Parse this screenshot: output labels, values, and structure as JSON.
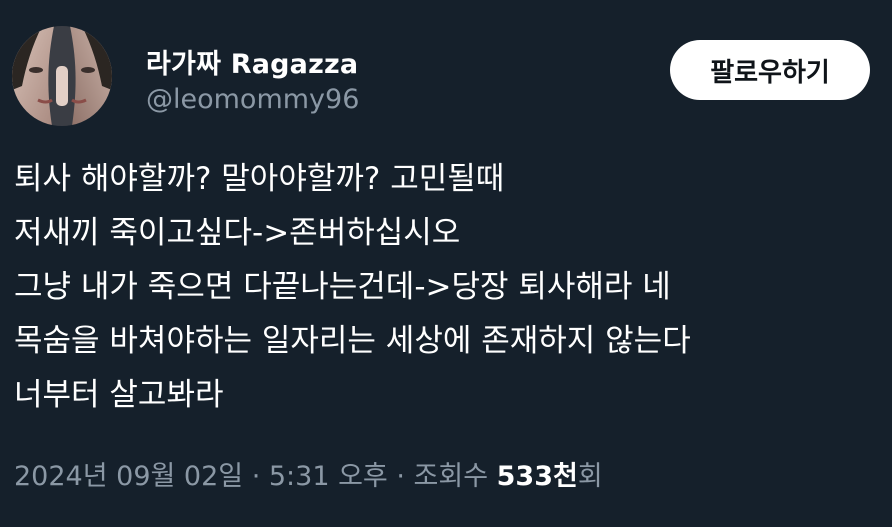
{
  "author": {
    "display_name": "라가짜 Ragazza",
    "handle": "@leomommy96",
    "avatar_icon": "profile-photo"
  },
  "follow_button": {
    "label": "팔로우하기"
  },
  "tweet": {
    "lines": [
      "퇴사 해야할까?  말아야할까?  고민될때",
      "저새끼 죽이고싶다->존버하십시오",
      "그냥 내가 죽으면 다끝나는건데->당장 퇴사해라 네",
      "목숨을 바쳐야하는 일자리는 세상에 존재하지 않는다",
      "너부터 살고봐라"
    ]
  },
  "meta": {
    "date": "2024년 09월 02일",
    "separator_1": " · ",
    "time": "5:31 오후",
    "separator_2": " · ",
    "views_label": "조회수 ",
    "views_count": "533천",
    "views_suffix": "회"
  },
  "colors": {
    "background": "#15202b",
    "text_primary": "#ffffff",
    "text_secondary": "#8b98a5",
    "button_bg": "#ffffff",
    "button_text": "#0f1419"
  }
}
